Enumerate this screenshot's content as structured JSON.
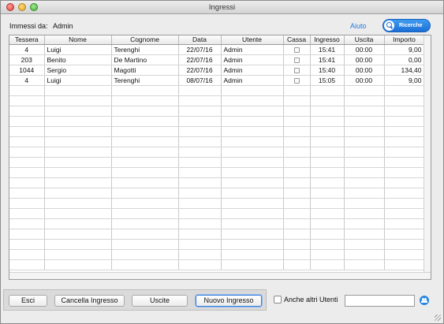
{
  "window": {
    "title": "Ingressi"
  },
  "header": {
    "operator_label": "Immessi da:",
    "operator_value": "Admin",
    "help_label": "Aiuto",
    "search_label": "Ricerche"
  },
  "table": {
    "columns": [
      "Tessera",
      "Nome",
      "Cognome",
      "Data",
      "Utente",
      "Cassa",
      "Ingresso",
      "Uscita",
      "Importo"
    ],
    "rows": [
      {
        "tessera": "4",
        "nome": "Luigi",
        "cognome": "Terenghi",
        "data": "22/07/16",
        "utente": "Admin",
        "cassa": false,
        "ingresso": "15:41",
        "uscita": "00:00",
        "importo": "9,00"
      },
      {
        "tessera": "203",
        "nome": "Benito",
        "cognome": "De Martino",
        "data": "22/07/16",
        "utente": "Admin",
        "cassa": false,
        "ingresso": "15:41",
        "uscita": "00:00",
        "importo": "0,00"
      },
      {
        "tessera": "1044",
        "nome": "Sergio",
        "cognome": "Magotti",
        "data": "22/07/16",
        "utente": "Admin",
        "cassa": false,
        "ingresso": "15:40",
        "uscita": "00:00",
        "importo": "134,40"
      },
      {
        "tessera": "4",
        "nome": "Luigi",
        "cognome": "Terenghi",
        "data": "08/07/16",
        "utente": "Admin",
        "cassa": false,
        "ingresso": "15:05",
        "uscita": "00:00",
        "importo": "9,00"
      }
    ]
  },
  "footer": {
    "exit_label": "Esci",
    "delete_label": "Cancella Ingresso",
    "exits_label": "Uscite",
    "new_label": "Nuovo Ingresso",
    "all_users_label": "Anche altri Utenti",
    "filter_value": ""
  },
  "icons": {
    "search": "magnifier-icon",
    "users": "users-icon"
  },
  "colors": {
    "accent": "#1f7de0",
    "search_button": "#2a7fe0"
  }
}
